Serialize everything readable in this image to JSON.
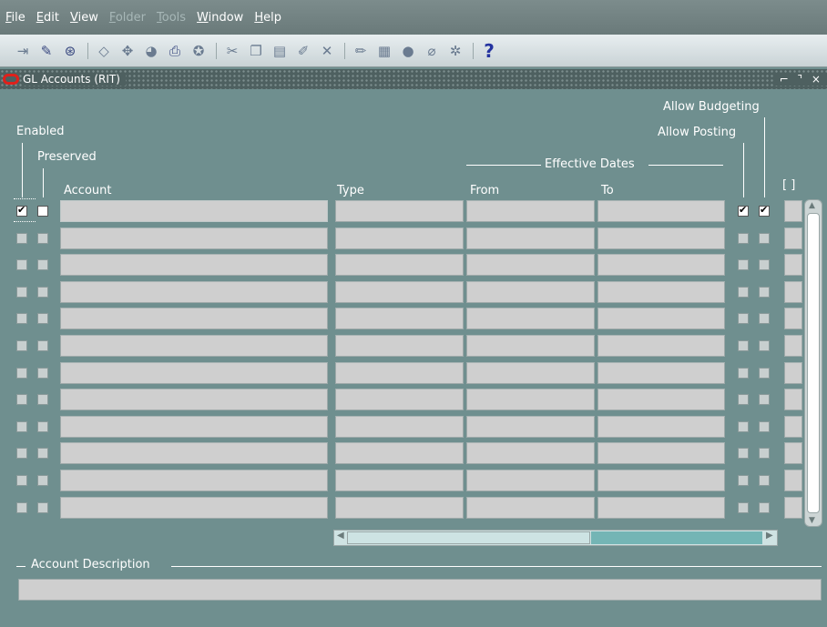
{
  "menubar": {
    "items": [
      {
        "label": "File",
        "enabled": true
      },
      {
        "label": "Edit",
        "enabled": true
      },
      {
        "label": "View",
        "enabled": true
      },
      {
        "label": "Folder",
        "enabled": false
      },
      {
        "label": "Tools",
        "enabled": false
      },
      {
        "label": "Window",
        "enabled": true
      },
      {
        "label": "Help",
        "enabled": true
      }
    ]
  },
  "toolbar": {
    "help_label": "?"
  },
  "window": {
    "title": "GL Accounts (RIT)",
    "controls": "⌐ ⌝ ×"
  },
  "headers": {
    "allow_budgeting": "Allow Budgeting",
    "allow_posting": "Allow Posting",
    "enabled": "Enabled",
    "preserved": "Preserved",
    "effective_dates": "Effective Dates",
    "account": "Account",
    "type": "Type",
    "from": "From",
    "to": "To",
    "folder_indicator": "[ ]"
  },
  "rows": [
    {
      "enabled": true,
      "preserved": false,
      "account": "",
      "type": "",
      "from": "",
      "to": "",
      "allow_posting": true,
      "allow_budgeting": true
    },
    {
      "enabled": false,
      "preserved": false,
      "account": "",
      "type": "",
      "from": "",
      "to": "",
      "allow_posting": false,
      "allow_budgeting": false
    },
    {
      "enabled": false,
      "preserved": false,
      "account": "",
      "type": "",
      "from": "",
      "to": "",
      "allow_posting": false,
      "allow_budgeting": false
    },
    {
      "enabled": false,
      "preserved": false,
      "account": "",
      "type": "",
      "from": "",
      "to": "",
      "allow_posting": false,
      "allow_budgeting": false
    },
    {
      "enabled": false,
      "preserved": false,
      "account": "",
      "type": "",
      "from": "",
      "to": "",
      "allow_posting": false,
      "allow_budgeting": false
    },
    {
      "enabled": false,
      "preserved": false,
      "account": "",
      "type": "",
      "from": "",
      "to": "",
      "allow_posting": false,
      "allow_budgeting": false
    },
    {
      "enabled": false,
      "preserved": false,
      "account": "",
      "type": "",
      "from": "",
      "to": "",
      "allow_posting": false,
      "allow_budgeting": false
    },
    {
      "enabled": false,
      "preserved": false,
      "account": "",
      "type": "",
      "from": "",
      "to": "",
      "allow_posting": false,
      "allow_budgeting": false
    },
    {
      "enabled": false,
      "preserved": false,
      "account": "",
      "type": "",
      "from": "",
      "to": "",
      "allow_posting": false,
      "allow_budgeting": false
    },
    {
      "enabled": false,
      "preserved": false,
      "account": "",
      "type": "",
      "from": "",
      "to": "",
      "allow_posting": false,
      "allow_budgeting": false
    },
    {
      "enabled": false,
      "preserved": false,
      "account": "",
      "type": "",
      "from": "",
      "to": "",
      "allow_posting": false,
      "allow_budgeting": false
    },
    {
      "enabled": false,
      "preserved": false,
      "account": "",
      "type": "",
      "from": "",
      "to": "",
      "allow_posting": false,
      "allow_budgeting": false
    }
  ],
  "description": {
    "label": "Account Description",
    "value": ""
  },
  "colors": {
    "background": "#6f8f8f",
    "field": "#cfcfcf",
    "oracle_red": "#e0201b"
  }
}
